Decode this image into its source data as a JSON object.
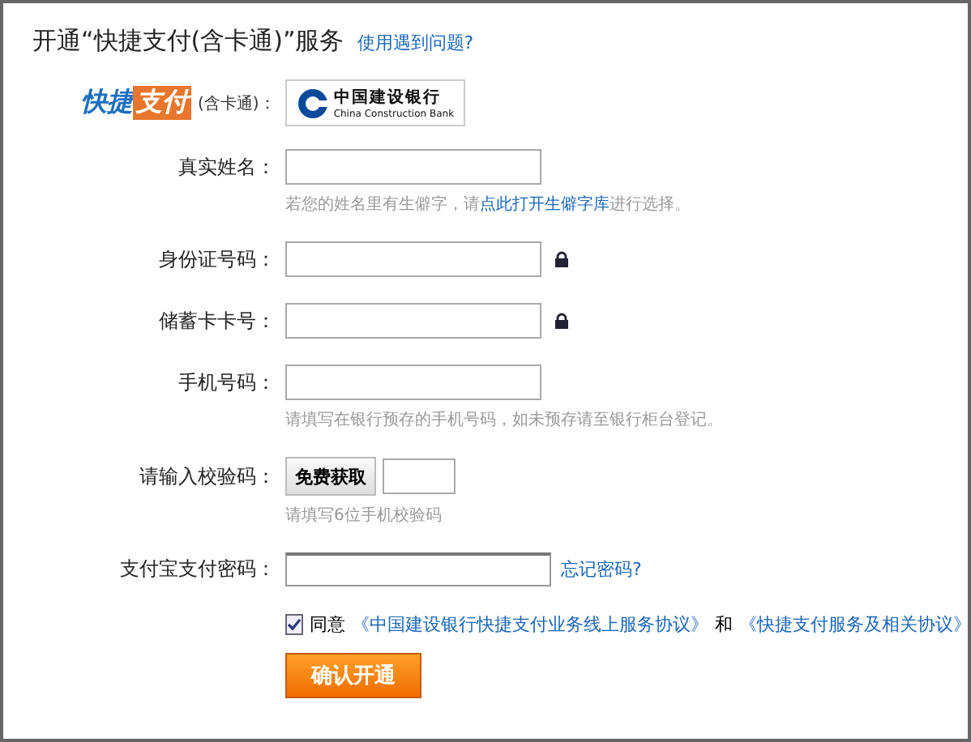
{
  "header": {
    "title": "开通“快捷支付(含卡通)”服务",
    "help_link": "使用遇到问题?"
  },
  "product": {
    "logo_left": "快捷",
    "logo_right": "支付",
    "note": "(含卡通)：",
    "bank_name": "中国建设银行",
    "bank_name_en": "China Construction Bank"
  },
  "fields": [
    {
      "label": "真实姓名：",
      "kind": "text",
      "lock": false,
      "hint": {
        "before": "若您的姓名里有生僻字，请",
        "link": "点此打开生僻字库",
        "after": "进行选择。"
      }
    },
    {
      "label": "身份证号码：",
      "kind": "text",
      "lock": true
    },
    {
      "label": "储蓄卡卡号：",
      "kind": "text",
      "lock": true
    },
    {
      "label": "手机号码：",
      "kind": "text",
      "lock": false,
      "hint": {
        "before": "请填写在银行预存的手机号码，如未预存请至银行柜台登记。"
      }
    },
    {
      "label": "请输入校验码：",
      "kind": "code",
      "lock": false,
      "button": "免费获取",
      "hint": {
        "before": "请填写6位手机校验码"
      }
    },
    {
      "label": "支付宝支付密码：",
      "kind": "password",
      "lock": false,
      "link": "忘记密码?"
    }
  ],
  "agreement": {
    "checked": true,
    "label": "同意",
    "link1": "《中国建设银行快捷支付业务线上服务协议》",
    "conj": "和",
    "link2": "《快捷支付服务及相关协议》"
  },
  "submit": "确认开通"
}
